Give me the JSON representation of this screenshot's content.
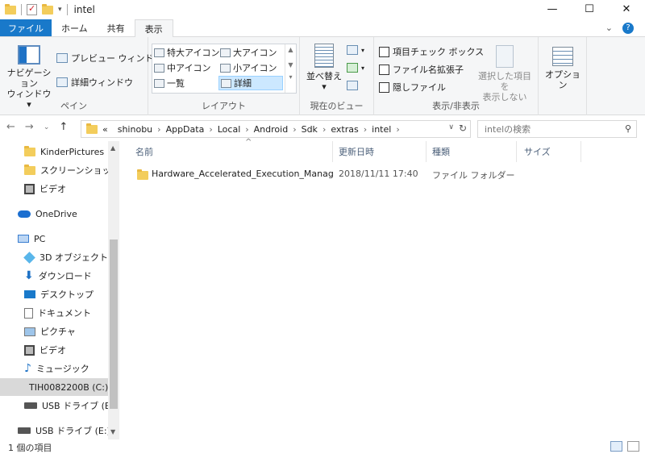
{
  "window": {
    "title": "intel",
    "minimize": "—",
    "maximize": "☐",
    "close": "✕"
  },
  "tabs": [
    "ファイル",
    "ホーム",
    "共有",
    "表示"
  ],
  "active_tab": "表示",
  "ribbon": {
    "pane_group": {
      "label": "ペイン",
      "nav_pane_label_1": "ナビゲーション",
      "nav_pane_label_2": "ウィンドウ ▾",
      "preview": "プレビュー ウィンドウ",
      "details": "詳細ウィンドウ"
    },
    "layout_group": {
      "label": "レイアウト",
      "items": [
        "特大アイコン",
        "大アイコン",
        "中アイコン",
        "小アイコン",
        "一覧",
        "詳細"
      ],
      "selected": "詳細"
    },
    "current_view_group": {
      "label": "現在のビュー",
      "sort_label_1": "並べ替え",
      "sort_label_2": "▾"
    },
    "show_hide_group": {
      "label": "表示/非表示",
      "checkbox_1": "項目チェック ボックス",
      "checkbox_2": "ファイル名拡張子",
      "checkbox_3": "隠しファイル",
      "hide_selected_1": "選択した項目を",
      "hide_selected_2": "表示しない"
    },
    "options": "オプション"
  },
  "address": {
    "prefix": "«",
    "crumbs": [
      "shinobu",
      "AppData",
      "Local",
      "Android",
      "Sdk",
      "extras",
      "intel"
    ],
    "search_placeholder": "intelの検索"
  },
  "nav_pane": {
    "items": [
      {
        "label": "KinderPictures",
        "icon": "folder-icon"
      },
      {
        "label": "スクリーンショット",
        "icon": "folder-icon"
      },
      {
        "label": "ビデオ",
        "icon": "video-icon"
      },
      {
        "label": "OneDrive",
        "icon": "cloud-icon"
      },
      {
        "label": "PC",
        "icon": "pc-icon"
      },
      {
        "label": "3D オブジェクト",
        "icon": "cube-icon"
      },
      {
        "label": "ダウンロード",
        "icon": "download-icon"
      },
      {
        "label": "デスクトップ",
        "icon": "desktop-icon"
      },
      {
        "label": "ドキュメント",
        "icon": "document-icon"
      },
      {
        "label": "ピクチャ",
        "icon": "picture-icon"
      },
      {
        "label": "ビデオ",
        "icon": "video-icon"
      },
      {
        "label": "ミュージック",
        "icon": "music-icon"
      },
      {
        "label": "TIH0082200B (C:)",
        "icon": "drive-icon"
      },
      {
        "label": "USB ドライブ (E:)",
        "icon": "drive-icon"
      },
      {
        "label": "USB ドライブ (E:)",
        "icon": "drive-icon"
      }
    ],
    "selected": "TIH0082200B (C:)"
  },
  "columns": {
    "name": "名前",
    "date": "更新日時",
    "type": "種類",
    "size": "サイズ"
  },
  "files": [
    {
      "name": "Hardware_Accelerated_Execution_Manag",
      "date": "2018/11/11 17:40",
      "type": "ファイル フォルダー",
      "size": ""
    }
  ],
  "status": {
    "item_count": "1 個の項目"
  },
  "colors": {
    "accent": "#1979ca",
    "folder": "#f3cd5c",
    "selection": "#cce8ff"
  }
}
